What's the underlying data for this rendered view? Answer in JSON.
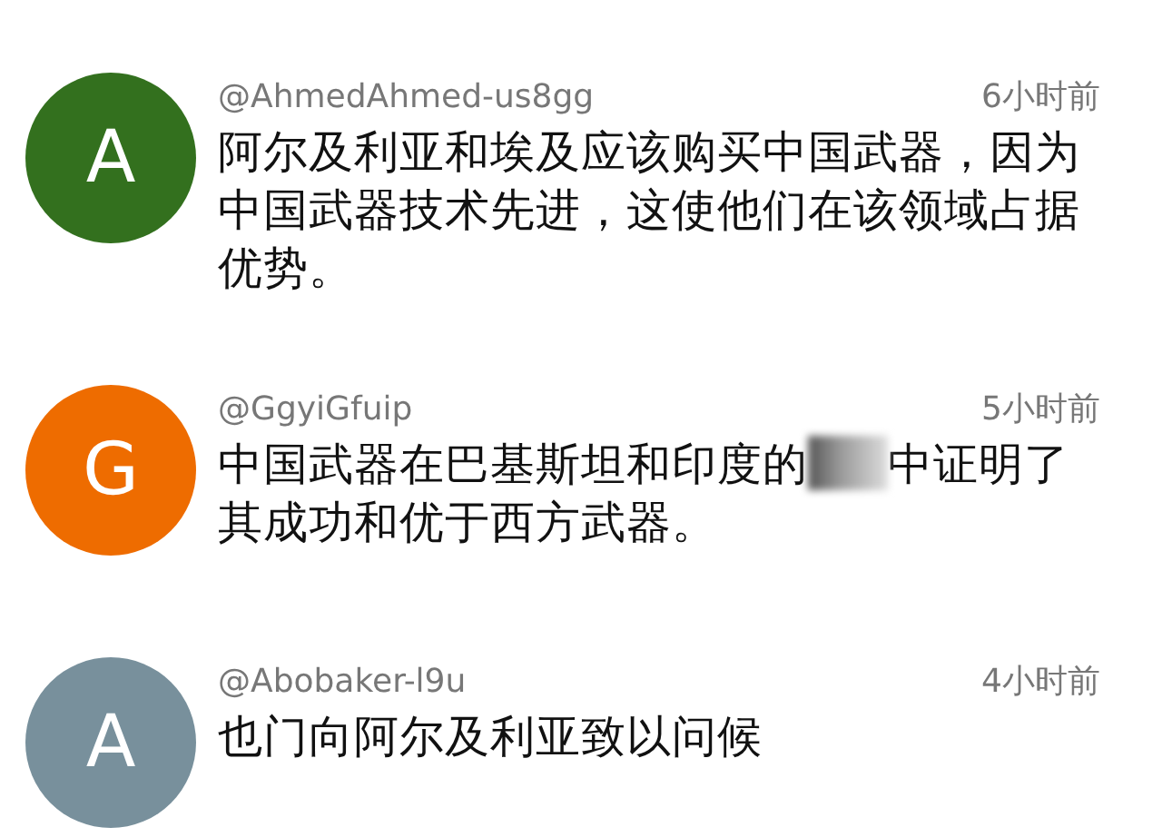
{
  "comments": [
    {
      "avatar_letter": "A",
      "color": "#33701e",
      "username": "@AhmedAhmed-us8gg",
      "time": "6小时前",
      "text": "阿尔及利亚和埃及应该购买中国武器，因为中国武器技术先进，这使他们在该领域占据优势。"
    },
    {
      "avatar_letter": "G",
      "color": "#ee6c00",
      "username": "@GgyiGfuip",
      "time": "5小时前",
      "text": "中国武器在巴基斯坦和印度的",
      "blurred": true,
      "text_after": "中证明了其成功和优于西方武器。"
    },
    {
      "avatar_letter": "A",
      "color": "#78909c",
      "username": "@Abobaker-l9u",
      "time": "4小时前",
      "text": "也门向阿尔及利亚致以问候"
    }
  ]
}
